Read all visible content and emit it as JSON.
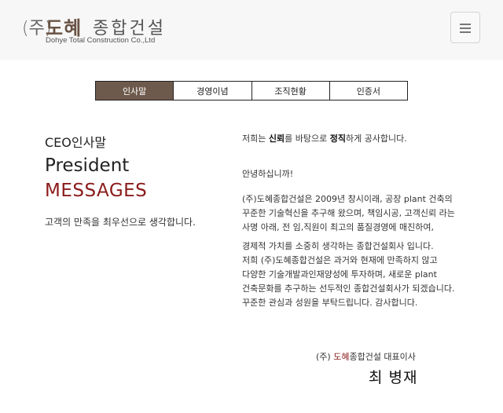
{
  "header": {
    "logo": {
      "paren": "(주)",
      "bold": "도혜",
      "light": "종합건설",
      "sub": "Dohye Total Construction Co.,Ltd"
    },
    "menu_icon": "hamburger-menu-icon"
  },
  "tabs": [
    {
      "label": "인사말",
      "active": true
    },
    {
      "label": "경영이념",
      "active": false
    },
    {
      "label": "조직현황",
      "active": false
    },
    {
      "label": "인증서",
      "active": false
    }
  ],
  "left": {
    "ceo_label": "CEO인사말",
    "president": "President",
    "messages": "MESSAGES",
    "subtitle": "고객의 만족을 최우선으로 생각합니다."
  },
  "right": {
    "motto": {
      "pre": "저희는 ",
      "word1": "신뢰",
      "mid": "를 바탕으로 ",
      "word2": "정직",
      "post": "하게 공사합니다."
    },
    "greeting": "안녕하십니까!",
    "para1": [
      "(주)도혜종합건설은 2009년 창시이래, 공장 plant 건축의",
      "꾸준한 기술혁신을 추구해 왔으며, 책임시공, 고객신뢰 라는",
      "사명 아래, 전 임,직원이 최고의 품질경영에 매진하여,"
    ],
    "para2": [
      "경제적 가치를 소중히 생각하는 종합건설회사 입니다.",
      "저희 (주)도혜종합건설은 과거와 현재에 만족하지 않고",
      "다양한 기술개발과인재양성에 투자하며, 새로운 plant",
      "건축문화를 추구하는 선두적인 종합건설회사가 되겠습니다.",
      "꾸준한 관심과 성원을 부탁드립니다. 감사합니다."
    ]
  },
  "signature": {
    "pre": "(주) ",
    "red": "도혜",
    "post": "종합건설 대표이사",
    "name": "최 병재"
  },
  "colors": {
    "brand_brown": "#6e5a4c",
    "accent_red": "#8b1b1b",
    "header_bg": "#f7f7f7"
  }
}
